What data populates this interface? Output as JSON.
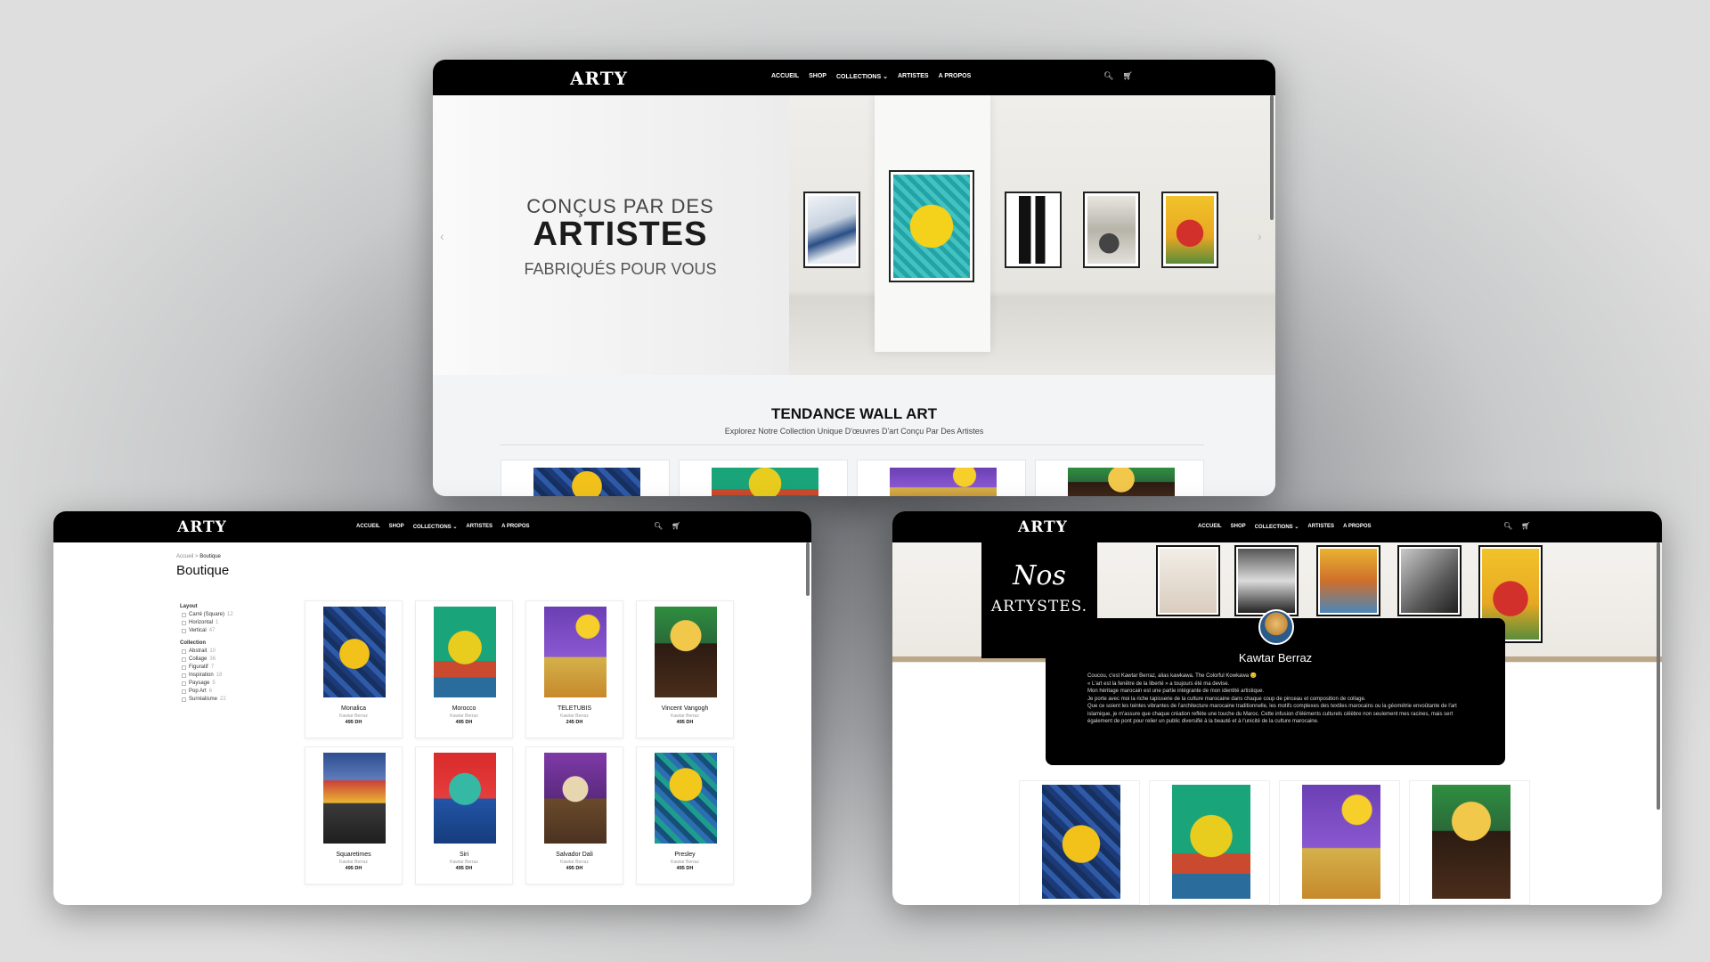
{
  "nav": {
    "logo": "ARTY",
    "accueil": "ACCUEIL",
    "shop": "SHOP",
    "collections": "COLLECTIONS",
    "artistes": "ARTISTES",
    "apropos": "A PROPOS",
    "search_icon": "search-icon",
    "cart_icon": "cart-icon"
  },
  "hero": {
    "line1": "CONÇUS PAR DES",
    "line2": "ARTISTES",
    "line3": "FABRIQUÉS POUR VOUS"
  },
  "trending": {
    "title": "TENDANCE WALL ART",
    "subtitle": "Explorez Notre Collection Unique D'œuvres D'art Conçu Par Des Artistes"
  },
  "shop_page": {
    "breadcrumb_home": "Accueil",
    "breadcrumb_sep": ">",
    "breadcrumb_current": "Boutique",
    "title": "Boutique",
    "filters": [
      {
        "heading": "Layout",
        "items": [
          {
            "label": "Carré (Square)",
            "count": "12"
          },
          {
            "label": "Horizontal",
            "count": "1"
          },
          {
            "label": "Vertical",
            "count": "47"
          }
        ]
      },
      {
        "heading": "Collection",
        "items": [
          {
            "label": "Abstrait",
            "count": "10"
          },
          {
            "label": "Collage",
            "count": "36"
          },
          {
            "label": "Figuratif",
            "count": "7"
          },
          {
            "label": "Inspiration",
            "count": "18"
          },
          {
            "label": "Paysage",
            "count": "5"
          },
          {
            "label": "Pop Art",
            "count": "6"
          },
          {
            "label": "Surréalisme",
            "count": "22"
          }
        ]
      }
    ],
    "products": [
      {
        "name": "Monalica",
        "artist": "Kawtar Berraz",
        "price": "495 DH"
      },
      {
        "name": "Morocco",
        "artist": "Kawtar Berraz",
        "price": "495 DH"
      },
      {
        "name": "TELETUBIS",
        "artist": "Kawtar Berraz",
        "price": "245 DH"
      },
      {
        "name": "Vincent Vangogh",
        "artist": "Kawtar Berraz",
        "price": "495 DH"
      },
      {
        "name": "Squaretimes",
        "artist": "Kawtar Berraz",
        "price": "495 DH"
      },
      {
        "name": "Siri",
        "artist": "Kawtar Berraz",
        "price": "495 DH"
      },
      {
        "name": "Salvador Dali",
        "artist": "Kawtar Berraz",
        "price": "495 DH"
      },
      {
        "name": "Presley",
        "artist": "Kawtar Berraz",
        "price": "495 DH"
      }
    ]
  },
  "artists_page": {
    "script_title": "Nos",
    "title": "ARTYSTES.",
    "artist_name": "Kawtar Berraz",
    "bio": [
      "Coucou, c'est Kawtar Berraz, alias kawkawa. The Colorful Kowkawa 😊",
      "« L'art est la fenêtre de la liberté » a toujours été ma devise.",
      "Mon héritage marocain est une partie intégrante de mon identité artistique.",
      "Je porte avec moi la riche tapisserie de la culture marocaine dans chaque coup de pinceau et composition de collage.",
      "Que ce soient les teintes vibrantes de l'architecture marocaine traditionnelle, les motifs complexes des textiles marocains ou la géométrie envoûtante de l'art islamique, je m'assure que chaque création reflète une touche du Maroc. Cette infusion d'éléments culturels célèbre non seulement mes racines, mais sert également de pont pour relier un public diversifié à la beauté et à l'unicité de la culture marocaine."
    ]
  }
}
